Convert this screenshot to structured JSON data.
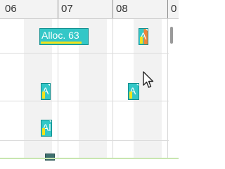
{
  "timeline": {
    "hours": [
      "06",
      "07",
      "08",
      "0"
    ]
  },
  "blocks": [
    {
      "label": "Alloc. 63",
      "progress": 0.85
    },
    {
      "label": "A",
      "progress": 0.4
    },
    {
      "label": "A",
      "progress": 0.4
    },
    {
      "label": "A",
      "progress": 0.4
    },
    {
      "label": "Al",
      "progress": 0.4
    },
    {
      "label": "Al",
      "progress": 0.4
    }
  ],
  "colors": {
    "block_fill": "#33c7c7",
    "block_border": "#0f8f8f",
    "progress_bar": "#f2e21a",
    "accent_orange": "#f0843a"
  }
}
